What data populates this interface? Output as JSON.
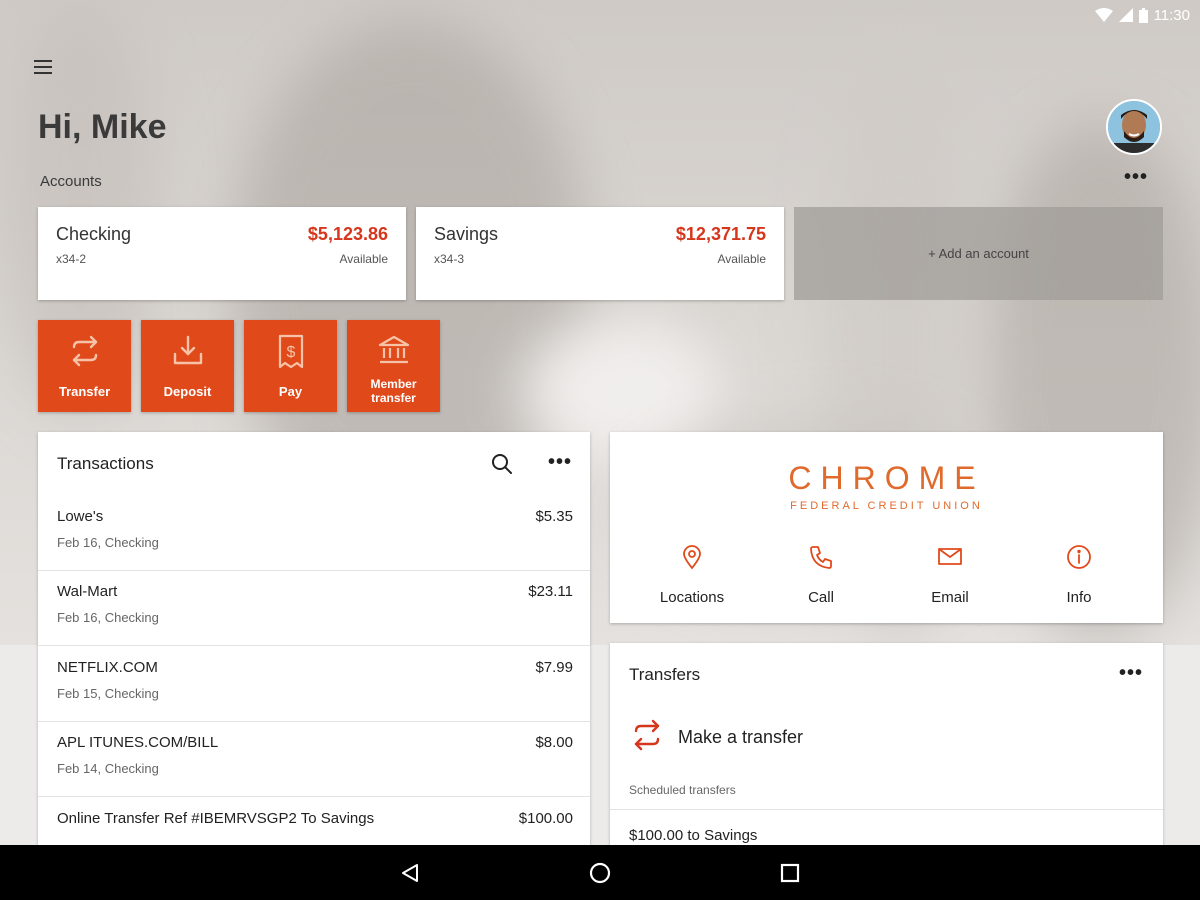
{
  "status_bar": {
    "time": "11:30"
  },
  "greeting": "Hi, Mike",
  "accounts": {
    "label": "Accounts",
    "items": [
      {
        "name": "Checking",
        "number": "x34-2",
        "balance": "$5,123.86",
        "balance_label": "Available"
      },
      {
        "name": "Savings",
        "number": "x34-3",
        "balance": "$12,371.75",
        "balance_label": "Available"
      }
    ],
    "add_label": "+ Add an account"
  },
  "actions": [
    {
      "label": "Transfer",
      "icon": "transfer-icon"
    },
    {
      "label": "Deposit",
      "icon": "deposit-icon"
    },
    {
      "label": "Pay",
      "icon": "bill-icon"
    },
    {
      "label": "Member transfer",
      "label_line1": "Member",
      "label_line2": "transfer",
      "icon": "bank-icon"
    }
  ],
  "transactions": {
    "title": "Transactions",
    "rows": [
      {
        "merchant": "Lowe's",
        "detail": "Feb 16, Checking",
        "amount": "$5.35"
      },
      {
        "merchant": "Wal-Mart",
        "detail": "Feb 16, Checking",
        "amount": "$23.11"
      },
      {
        "merchant": "NETFLIX.COM",
        "detail": "Feb 15, Checking",
        "amount": "$7.99"
      },
      {
        "merchant": "APL ITUNES.COM/BILL",
        "detail": "Feb 14, Checking",
        "amount": "$8.00"
      },
      {
        "merchant": "Online Transfer Ref #IBEMRVSGP2 To Savings",
        "detail": "",
        "amount": "$100.00"
      }
    ]
  },
  "credit_union": {
    "name": "CHROME",
    "subtitle": "FEDERAL CREDIT UNION",
    "links": [
      {
        "label": "Locations",
        "icon": "location-pin-icon"
      },
      {
        "label": "Call",
        "icon": "phone-icon"
      },
      {
        "label": "Email",
        "icon": "email-icon"
      },
      {
        "label": "Info",
        "icon": "info-icon"
      }
    ]
  },
  "transfers": {
    "title": "Transfers",
    "make_label": "Make a transfer",
    "scheduled_label": "Scheduled transfers",
    "scheduled": [
      {
        "label": "$100.00 to Savings"
      }
    ]
  },
  "colors": {
    "accent": "#e04a1b",
    "balance": "#d6361c",
    "logo": "#e06a2c"
  }
}
